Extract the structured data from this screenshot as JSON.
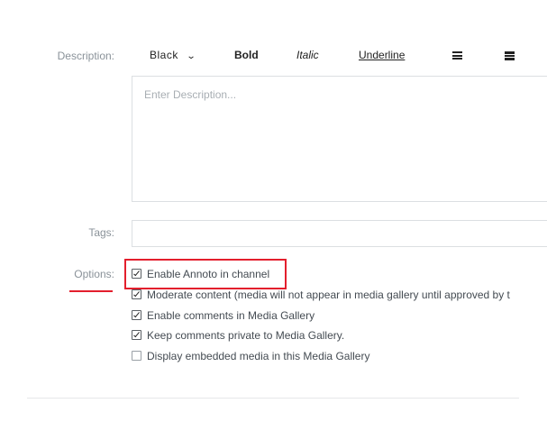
{
  "labels": {
    "description": "Description:",
    "tags": "Tags:",
    "options": "Options:"
  },
  "toolbar": {
    "color_value": "Black",
    "bold": "Bold",
    "italic": "Italic",
    "underline": "Underline",
    "icons": [
      "list-icon",
      "list-thick-icon",
      "chevron-down-icon"
    ]
  },
  "description": {
    "placeholder": "Enter Description...",
    "value": ""
  },
  "tags": {
    "value": ""
  },
  "options": [
    {
      "label": "Enable Annoto in channel",
      "checked": true
    },
    {
      "label": "Moderate content (media will not appear in media gallery until approved by t",
      "checked": true
    },
    {
      "label": "Enable comments in Media Gallery",
      "checked": true
    },
    {
      "label": "Keep comments private to Media Gallery.",
      "checked": true
    },
    {
      "label": "Display embedded media in this Media Gallery",
      "checked": false
    }
  ],
  "colors": {
    "highlight": "#e31f2d",
    "label": "#8a9299",
    "border": "#dcdfe2"
  }
}
